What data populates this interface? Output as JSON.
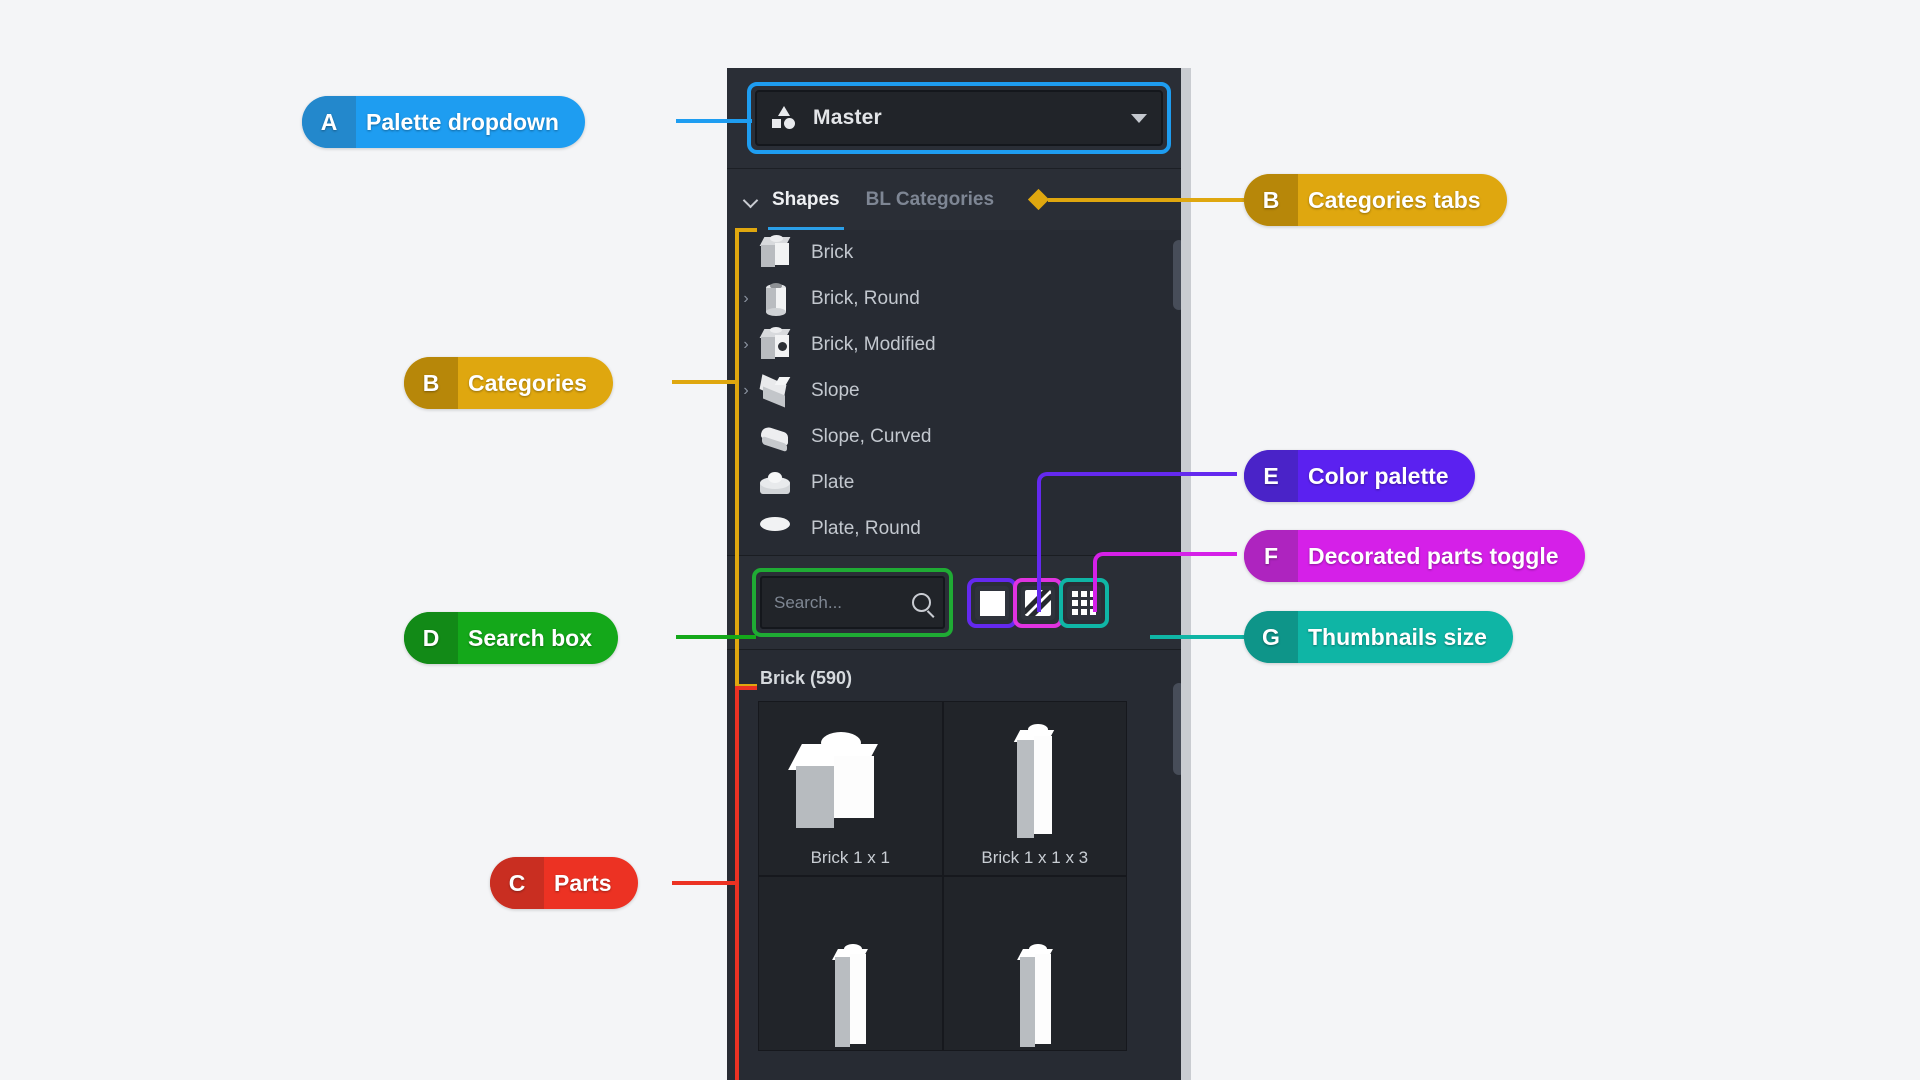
{
  "app": {
    "background": "#f4f5f7",
    "panel_bg": "#2a2e36",
    "panel_alt_bg": "#272b33"
  },
  "panel": {
    "dropdown": {
      "label": "Master",
      "icon": "shapes-icon",
      "caret": "chevron-down-icon"
    },
    "tabs": {
      "collapse_icon": "chevron-down-icon",
      "items": [
        {
          "label": "Shapes",
          "active": true
        },
        {
          "label": "BL Categories",
          "active": false
        }
      ],
      "active_underline_color": "#2b9fe8"
    },
    "categories": {
      "items": [
        {
          "label": "Brick",
          "expandable": false,
          "icon": "brick-icon"
        },
        {
          "label": "Brick, Round",
          "expandable": true,
          "icon": "brick-round-icon"
        },
        {
          "label": "Brick, Modified",
          "expandable": true,
          "icon": "brick-modified-icon"
        },
        {
          "label": "Slope",
          "expandable": true,
          "icon": "slope-icon"
        },
        {
          "label": "Slope, Curved",
          "expandable": false,
          "icon": "slope-curved-icon"
        },
        {
          "label": "Plate",
          "expandable": false,
          "icon": "plate-icon"
        },
        {
          "label": "Plate, Round",
          "expandable": false,
          "icon": "plate-round-icon"
        }
      ]
    },
    "toolbar": {
      "search_placeholder": "Search...",
      "search_value": "",
      "search_icon": "magnifier-icon",
      "color_palette_button": {
        "icon": "color-swatch-icon",
        "swatch_color": "#ffffff"
      },
      "decorated_parts_button": {
        "icon": "decorated-parts-icon"
      },
      "thumbnails_size_button": {
        "icon": "grid-3x3-icon"
      }
    },
    "parts": {
      "header": "Brick (590)",
      "items": [
        {
          "name": "Brick 1 x 1",
          "icon": "brick-1x1-thumb"
        },
        {
          "name": "Brick 1 x 1 x 3",
          "icon": "brick-1x1x3-thumb"
        },
        {
          "name": "",
          "icon": "brick-tall-thumb"
        },
        {
          "name": "",
          "icon": "brick-tall-thumb"
        }
      ]
    }
  },
  "annotations": [
    {
      "letter": "A",
      "label": "Palette dropdown",
      "color": "#1e9df1",
      "dark": "#2388cc"
    },
    {
      "letter": "B",
      "label": "Categories tabs",
      "color": "#dfa70f",
      "dark": "#b78709"
    },
    {
      "letter": "B",
      "label": "Categories",
      "color": "#dfa70f",
      "dark": "#b78709"
    },
    {
      "letter": "C",
      "label": "Parts",
      "color": "#ec3223",
      "dark": "#c92e21"
    },
    {
      "letter": "D",
      "label": "Search box",
      "color": "#14a81a",
      "dark": "#128a17"
    },
    {
      "letter": "E",
      "label": "Color palette",
      "color": "#5b21f0",
      "dark": "#4a23c8"
    },
    {
      "letter": "F",
      "label": "Decorated parts toggle",
      "color": "#d520e8",
      "dark": "#ae24bf"
    },
    {
      "letter": "G",
      "label": "Thumbnails size",
      "color": "#0fb5a5",
      "dark": "#0e9589"
    }
  ]
}
